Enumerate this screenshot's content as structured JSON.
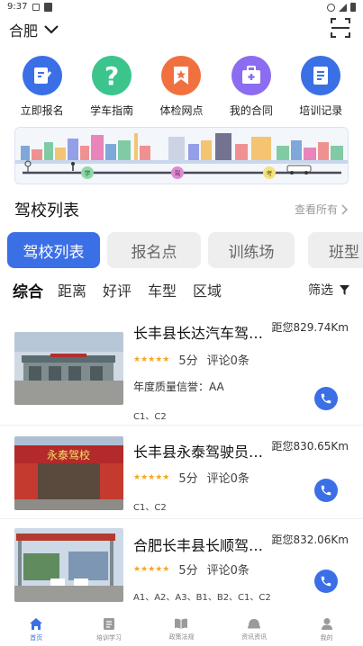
{
  "status_bar": {
    "time": "9:37"
  },
  "header": {
    "city": "合肥"
  },
  "quick_actions": [
    {
      "label": "立即报名",
      "icon": "edit-form-icon",
      "color": "#3b6fe6"
    },
    {
      "label": "学车指南",
      "icon": "question-icon",
      "color": "#3cc48d"
    },
    {
      "label": "体检网点",
      "icon": "bookmark-star-icon",
      "color": "#f0713f"
    },
    {
      "label": "我的合同",
      "icon": "briefcase-medical-icon",
      "color": "#8c6cf0"
    },
    {
      "label": "培训记录",
      "icon": "document-list-icon",
      "color": "#3b6fe6"
    }
  ],
  "banner": {
    "stops": [
      "学",
      "驾",
      "考"
    ]
  },
  "section": {
    "title": "驾校列表",
    "see_all": "查看所有"
  },
  "tabs": [
    {
      "label": "驾校列表",
      "active": true
    },
    {
      "label": "报名点",
      "active": false
    },
    {
      "label": "训练场",
      "active": false
    },
    {
      "label": "班型",
      "active": false
    }
  ],
  "filters": {
    "items": [
      {
        "label": "综合",
        "active": true
      },
      {
        "label": "距离",
        "active": false
      },
      {
        "label": "好评",
        "active": false
      },
      {
        "label": "车型",
        "active": false
      },
      {
        "label": "区域",
        "active": false
      }
    ],
    "filter_label": "筛选"
  },
  "schools": [
    {
      "name": "长丰县长达汽车驾驶培训有限公司",
      "distance": "距您829.74Km",
      "stars": "★★★★★",
      "score": "5分",
      "comments": "评论0条",
      "quality": "年度质量信誉：AA",
      "license": "C1、C2"
    },
    {
      "name": "长丰县永泰驾驶员培训有限公司",
      "distance": "距您830.65Km",
      "stars": "★★★★★",
      "score": "5分",
      "comments": "评论0条",
      "quality": "",
      "license": "C1、C2",
      "sign_text": "永泰驾校"
    },
    {
      "name": "合肥长丰县长顺驾驶培训有限公司",
      "distance": "距您832.06Km",
      "stars": "★★★★★",
      "score": "5分",
      "comments": "评论0条",
      "quality": "",
      "license": "A1、A2、A3、B1、B2、C1、C2"
    }
  ],
  "bottom_nav": [
    {
      "label": "首页",
      "icon": "home-icon",
      "active": true
    },
    {
      "label": "培训学习",
      "icon": "book-icon",
      "active": false
    },
    {
      "label": "政策法规",
      "icon": "open-book-icon",
      "active": false
    },
    {
      "label": "资讯资讯",
      "icon": "helmet-icon",
      "active": false
    },
    {
      "label": "我的",
      "icon": "user-icon",
      "active": false
    }
  ]
}
